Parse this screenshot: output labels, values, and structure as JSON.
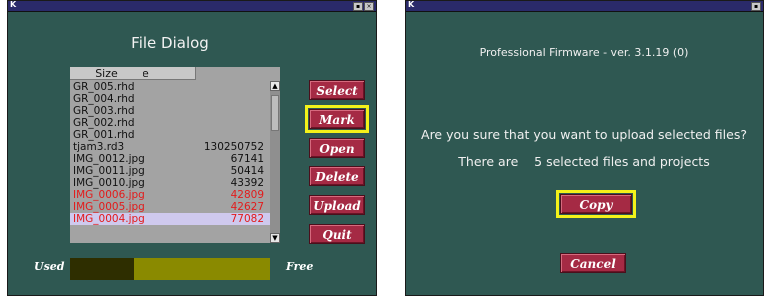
{
  "left_window": {
    "title": "File Dialog",
    "titlebar_letter": "K",
    "columns": {
      "name": "Name",
      "size": "Size"
    },
    "files": [
      {
        "name": "GR_005.rhd",
        "size": "",
        "color": "normal"
      },
      {
        "name": "GR_004.rhd",
        "size": "",
        "color": "normal"
      },
      {
        "name": "GR_003.rhd",
        "size": "",
        "color": "normal"
      },
      {
        "name": "GR_002.rhd",
        "size": "",
        "color": "normal"
      },
      {
        "name": "GR_001.rhd",
        "size": "",
        "color": "normal"
      },
      {
        "name": "tjam3.rd3",
        "size": "130250752",
        "color": "normal"
      },
      {
        "name": "IMG_0012.jpg",
        "size": "67141",
        "color": "normal"
      },
      {
        "name": "IMG_0011.jpg",
        "size": "50414",
        "color": "normal"
      },
      {
        "name": "IMG_0010.jpg",
        "size": "43392",
        "color": "normal"
      },
      {
        "name": "IMG_0006.jpg",
        "size": "42809",
        "color": "red"
      },
      {
        "name": "IMG_0005.jpg",
        "size": "42627",
        "color": "red"
      },
      {
        "name": "IMG_0004.jpg",
        "size": "77082",
        "color": "red-selected"
      }
    ],
    "buttons": {
      "select": "Select",
      "mark": "Mark",
      "open": "Open",
      "delete": "Delete",
      "upload": "Upload",
      "quit": "Quit"
    },
    "storage": {
      "used_label": "Used",
      "free_label": "Free",
      "used_fraction": 0.32
    }
  },
  "right_window": {
    "titlebar_letter": "K",
    "firmware": "Professional Firmware - ver. 3.1.19 (0)",
    "question": "Are you sure that you want to upload selected files?",
    "count_text": "There are    5 selected files and projects",
    "copy_button": "Copy",
    "cancel_button": "Cancel"
  },
  "colors": {
    "window_bg": "#2f5852",
    "button_bg": "#a52a44",
    "highlight": "#f4f11a",
    "marked_text": "#e31b1b"
  }
}
